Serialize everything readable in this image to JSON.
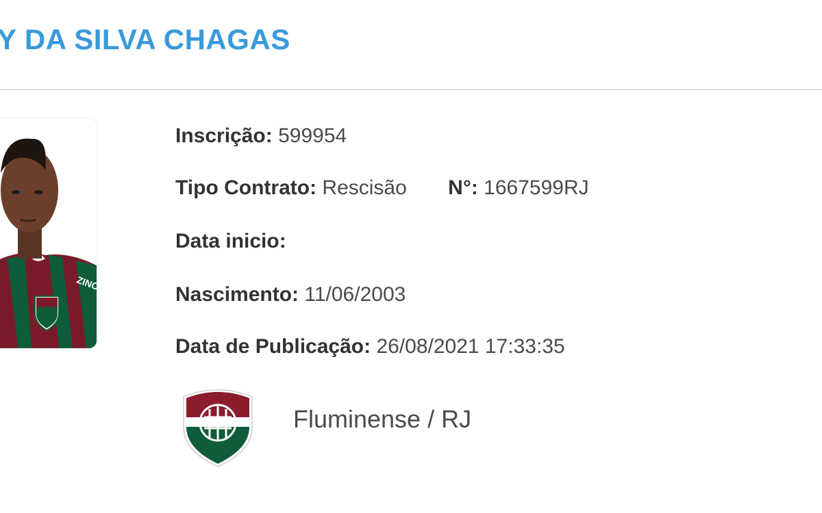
{
  "player": {
    "name": "Y DA SILVA CHAGAS"
  },
  "details": {
    "inscricao_label": "Inscrição:",
    "inscricao_value": "599954",
    "tipo_contrato_label": "Tipo Contrato:",
    "tipo_contrato_value": "Rescisão",
    "numero_label": "N°:",
    "numero_value": "1667599RJ",
    "data_inicio_label": "Data inicio:",
    "data_inicio_value": "",
    "nascimento_label": "Nascimento:",
    "nascimento_value": "11/06/2003",
    "publicacao_label": "Data de Publicação:",
    "publicacao_value": "26/08/2021 17:33:35"
  },
  "club": {
    "name": "Fluminense / RJ",
    "logo_icon": "fluminense-crest-icon",
    "colors": {
      "maroon": "#8b1c2c",
      "green": "#0f5c3a",
      "white": "#ffffff"
    }
  },
  "theme": {
    "title_color": "#3a9ad9",
    "divider_color": "#e2e2e2"
  }
}
